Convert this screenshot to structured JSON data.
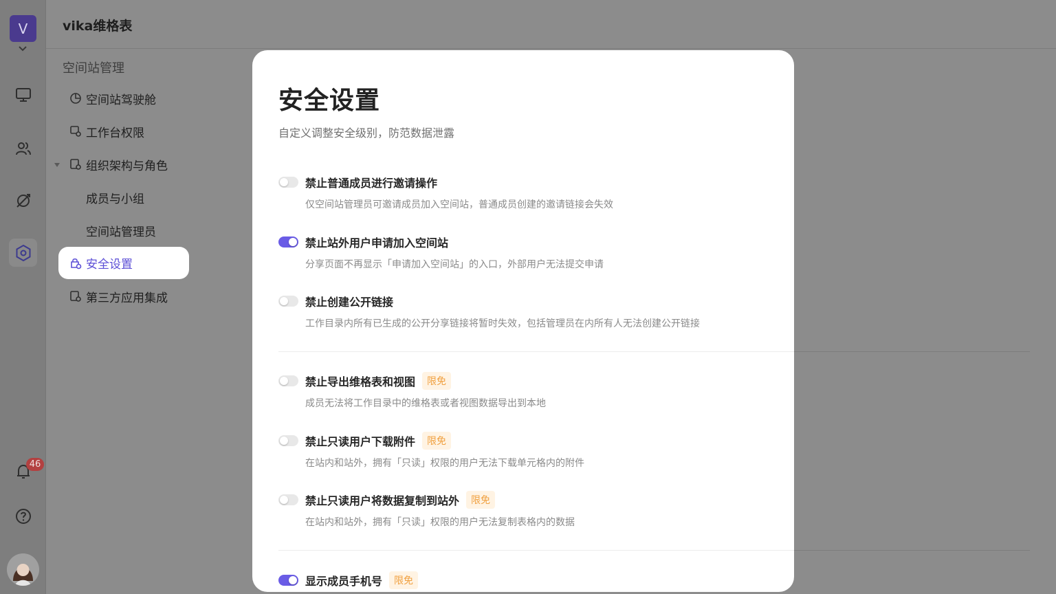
{
  "app": {
    "title": "vika维格表",
    "space_initial": "V"
  },
  "rail": {
    "notification_count": "46"
  },
  "sidebar": {
    "section_title": "空间站管理",
    "items": [
      {
        "label": "空间站驾驶舱",
        "icon": "pie-chart-icon"
      },
      {
        "label": "工作台权限",
        "icon": "workbench-icon"
      },
      {
        "label": "组织架构与角色",
        "icon": "org-icon"
      },
      {
        "label": "成员与小组",
        "icon": ""
      },
      {
        "label": "空间站管理员",
        "icon": ""
      },
      {
        "label": "安全设置",
        "icon": "security-icon"
      },
      {
        "label": "第三方应用集成",
        "icon": "integration-icon"
      }
    ]
  },
  "modal": {
    "title": "安全设置",
    "subtitle": "自定义调整安全级别，防范数据泄露",
    "tag_label": "限免",
    "settings": [
      {
        "label": "禁止普通成员进行邀请操作",
        "desc": "仅空间站管理员可邀请成员加入空间站，普通成员创建的邀请链接会失效",
        "enabled": false
      },
      {
        "label": "禁止站外用户申请加入空间站",
        "desc": "分享页面不再显示「申请加入空间站」的入口，外部用户无法提交申请",
        "enabled": true
      },
      {
        "label": "禁止创建公开链接",
        "desc": "工作目录内所有已生成的公开分享链接将暂时失效，包括管理员在内所有人无法创建公开链接",
        "enabled": false
      },
      {
        "label": "禁止导出维格表和视图",
        "desc": "成员无法将工作目录中的维格表或者视图数据导出到本地",
        "enabled": false
      },
      {
        "label": "禁止只读用户下载附件",
        "desc": "在站内和站外，拥有「只读」权限的用户无法下载单元格内的附件",
        "enabled": false
      },
      {
        "label": "禁止只读用户将数据复制到站外",
        "desc": "在站内和站外，拥有「只读」权限的用户无法复制表格内的数据",
        "enabled": false
      },
      {
        "label": "显示成员手机号",
        "desc": "",
        "enabled": true
      }
    ]
  },
  "colors": {
    "accent": "#6a5ce6",
    "tag_text": "#f0a040",
    "tag_bg": "#fff3e3"
  }
}
